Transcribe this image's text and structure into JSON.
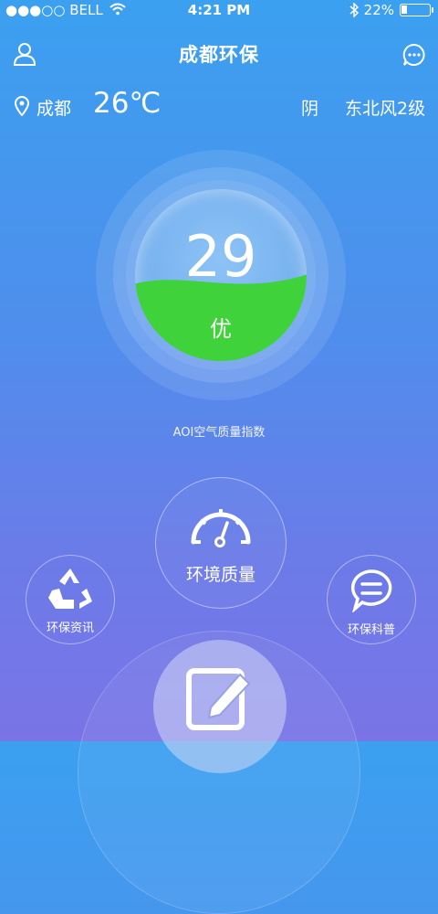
{
  "status_bar": {
    "carrier": "●●●○○ BELL",
    "time": "4:21 PM",
    "battery": "22%",
    "battery_level": 0.22
  },
  "header": {
    "title": "成都环保",
    "user_icon": "user-icon",
    "message_icon": "chat-bubble-icon"
  },
  "weather": {
    "city": "成都",
    "temperature": "26℃",
    "condition": "阴",
    "wind": "东北风2级"
  },
  "aqi": {
    "value": "29",
    "level": "优",
    "caption": "AOI空气质量指数",
    "fill_level": 0.45,
    "fill_color": "#3fd23b"
  },
  "actions": {
    "environment_quality": "环境质量",
    "env_news": "环保资讯",
    "env_science": "环保科普"
  },
  "colors": {
    "bg_top": "#3ba0f0",
    "bg_bottom": "#7a74e6",
    "accent_green": "#3fd23b"
  }
}
